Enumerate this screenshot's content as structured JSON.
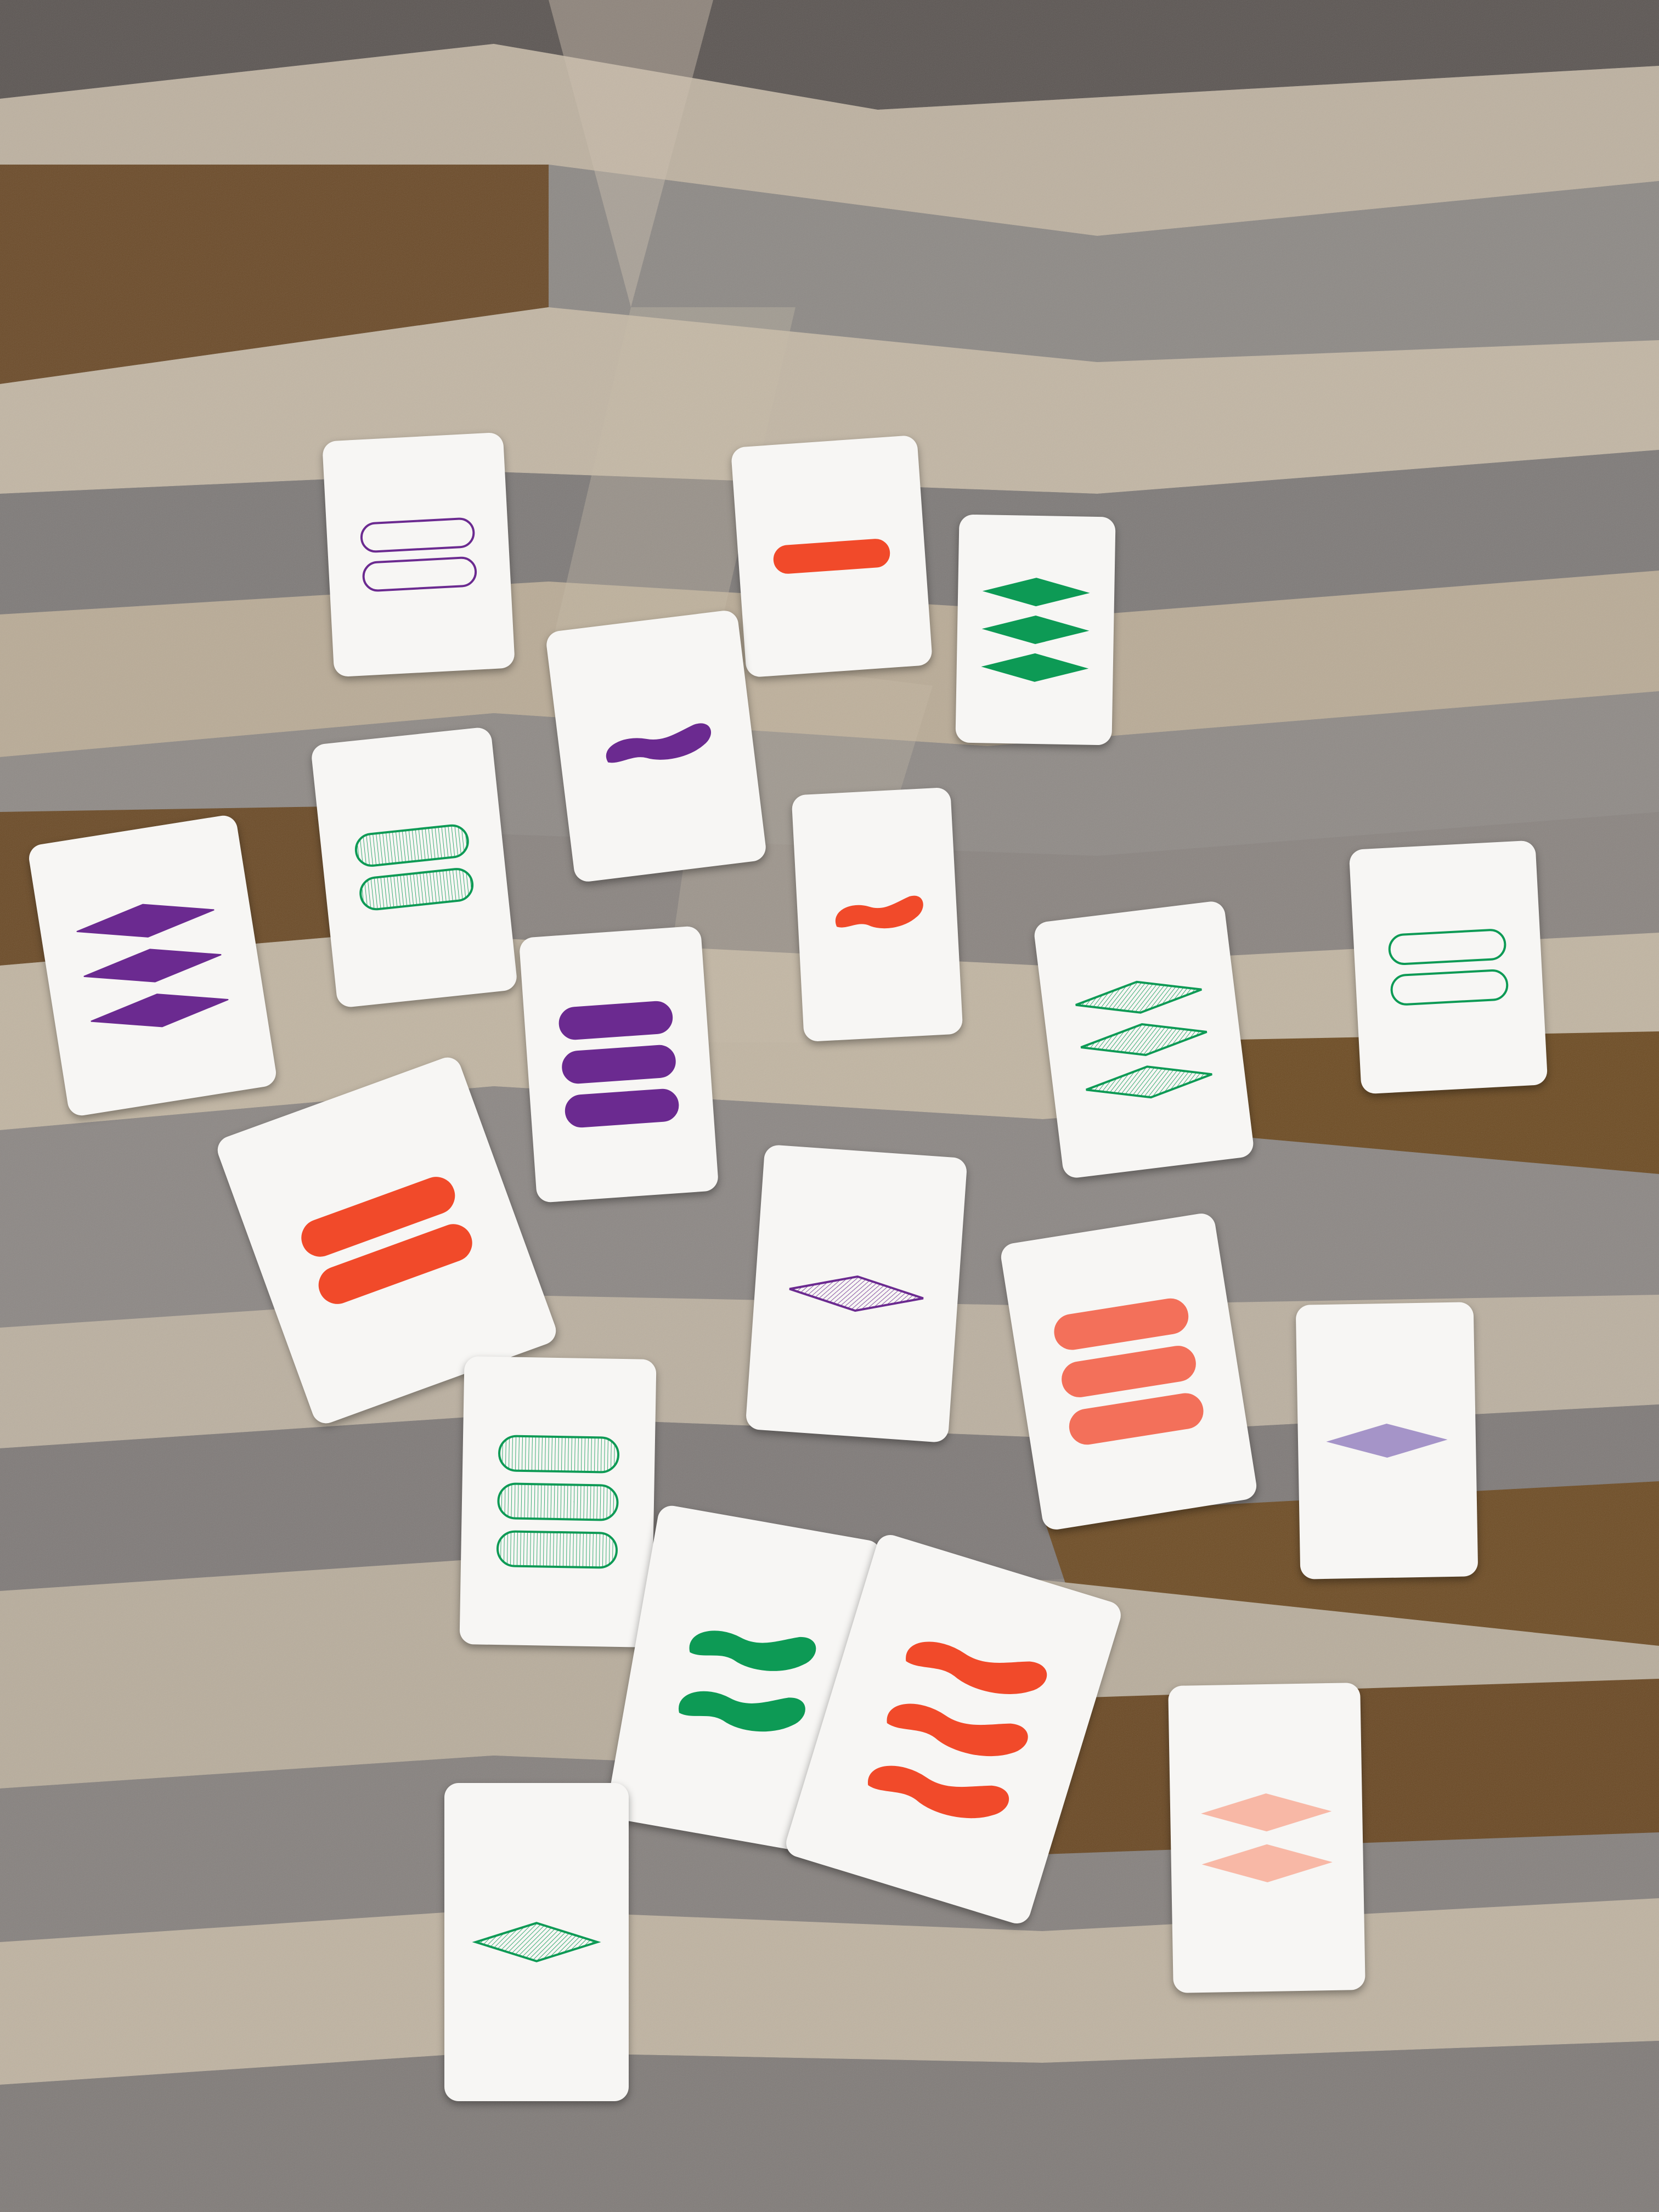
{
  "game": "Set",
  "colors": {
    "red": "#f14a2a",
    "purple": "#6b2a90",
    "green": "#0d9a55",
    "lavender": "#a594c8",
    "peach": "#f8b8a6",
    "salmon": "#f3705a",
    "mint": "#2fae6e",
    "card": "#f7f6f4"
  },
  "cards": [
    {
      "id": "c01",
      "count": 2,
      "shape": "oval",
      "color": "purple",
      "fill": "open"
    },
    {
      "id": "c02",
      "count": 1,
      "shape": "oval",
      "color": "red",
      "fill": "solid"
    },
    {
      "id": "c03",
      "count": 3,
      "shape": "diamond",
      "color": "green",
      "fill": "solid"
    },
    {
      "id": "c04",
      "count": 1,
      "shape": "squiggle",
      "color": "purple",
      "fill": "solid"
    },
    {
      "id": "c05",
      "count": 2,
      "shape": "oval",
      "color": "green",
      "fill": "striped"
    },
    {
      "id": "c06",
      "count": 3,
      "shape": "diamond",
      "color": "purple",
      "fill": "solid"
    },
    {
      "id": "c07",
      "count": 1,
      "shape": "squiggle",
      "color": "red",
      "fill": "solid"
    },
    {
      "id": "c08",
      "count": 3,
      "shape": "oval",
      "color": "purple",
      "fill": "solid"
    },
    {
      "id": "c09",
      "count": 3,
      "shape": "diamond",
      "color": "green",
      "fill": "striped"
    },
    {
      "id": "c10",
      "count": 2,
      "shape": "oval",
      "color": "green",
      "fill": "open"
    },
    {
      "id": "c11",
      "count": 2,
      "shape": "oval",
      "color": "red",
      "fill": "solid"
    },
    {
      "id": "c12",
      "count": 1,
      "shape": "diamond",
      "color": "purple",
      "fill": "striped"
    },
    {
      "id": "c13",
      "count": 3,
      "shape": "oval",
      "color": "salmon",
      "fill": "solid"
    },
    {
      "id": "c14",
      "count": 1,
      "shape": "diamond",
      "color": "lavender",
      "fill": "solid"
    },
    {
      "id": "c15",
      "count": 3,
      "shape": "oval",
      "color": "green",
      "fill": "striped"
    },
    {
      "id": "c16",
      "count": 2,
      "shape": "squiggle",
      "color": "green",
      "fill": "solid"
    },
    {
      "id": "c17",
      "count": 3,
      "shape": "squiggle",
      "color": "red",
      "fill": "solid"
    },
    {
      "id": "c18",
      "count": 2,
      "shape": "diamond",
      "color": "peach",
      "fill": "solid"
    },
    {
      "id": "c19",
      "count": 1,
      "shape": "diamond",
      "color": "green",
      "fill": "striped"
    }
  ]
}
